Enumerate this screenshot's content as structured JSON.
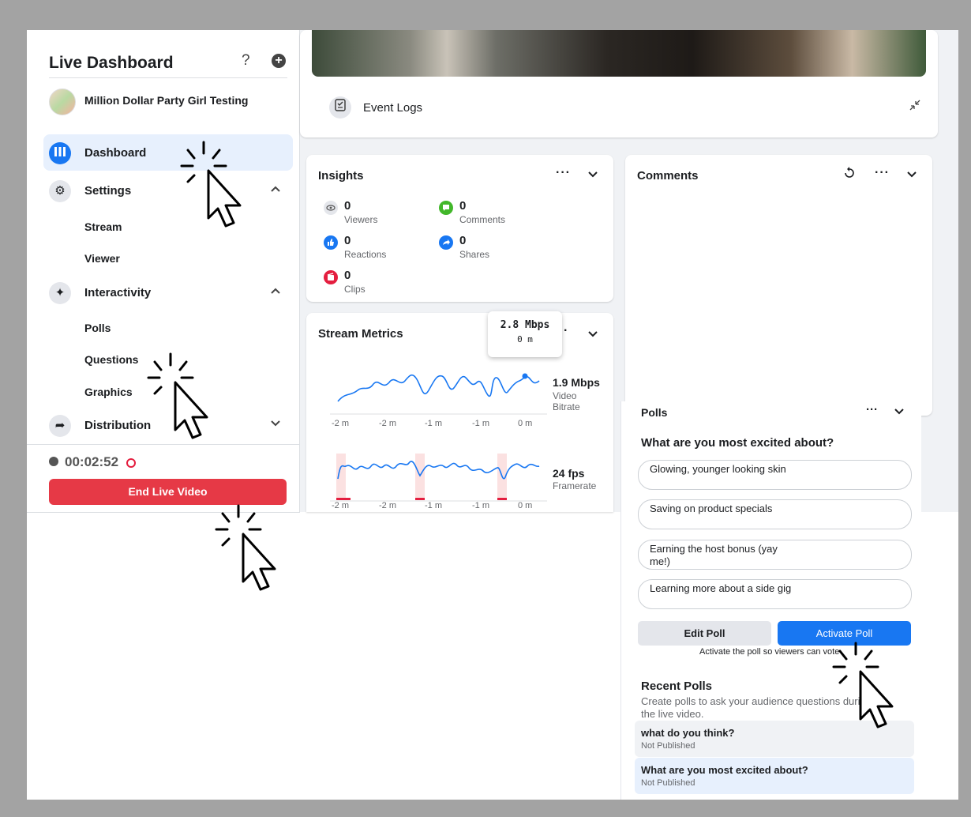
{
  "sidebar": {
    "title": "Live Dashboard",
    "help_glyph": "?",
    "add_glyph": "+",
    "page_name": "Million Dollar Party Girl Testing",
    "nav": [
      {
        "label": "Dashboard",
        "icon": "dashboard-icon"
      },
      {
        "label": "Settings",
        "icon": "gear-icon"
      },
      {
        "label": "Interactivity",
        "icon": "sparkle-icon"
      },
      {
        "label": "Distribution",
        "icon": "share-arrow-icon"
      }
    ],
    "settings_sub": [
      "Stream",
      "Viewer"
    ],
    "interactivity_sub": [
      "Polls",
      "Questions",
      "Graphics"
    ],
    "timer": "00:02:52",
    "end_label": "End Live Video"
  },
  "main": {
    "event_logs_label": "Event Logs"
  },
  "insights": {
    "title": "Insights",
    "metrics": [
      {
        "value": "0",
        "label": "Viewers",
        "color": "#e4e6eb"
      },
      {
        "value": "0",
        "label": "Comments",
        "color": "#42b72a"
      },
      {
        "value": "0",
        "label": "Reactions",
        "color": "#1877f2"
      },
      {
        "value": "0",
        "label": "Shares",
        "color": "#1877f2"
      },
      {
        "value": "0",
        "label": "Clips",
        "color": "#e41e3f"
      }
    ]
  },
  "comments": {
    "title": "Comments"
  },
  "stream_metrics": {
    "title": "Stream Metrics",
    "tooltip_value": "2.8 Mbps",
    "tooltip_time": "0 m",
    "bitrate_value": "1.9 Mbps",
    "bitrate_label_1": "Video",
    "bitrate_label_2": "Bitrate",
    "framerate_value": "24 fps",
    "framerate_label": "Framerate",
    "ticks": [
      "-2 m",
      "-2 m",
      "-1 m",
      "-1 m",
      "0 m"
    ],
    "line_color": "#1877f2"
  },
  "polls": {
    "title": "Polls",
    "question": "What are you most excited about?",
    "options": [
      "Glowing, younger looking skin",
      "Saving on product specials",
      "Earning the host bonus (yay me!)",
      "Learning more about a side gig"
    ],
    "edit_label": "Edit Poll",
    "activate_label": "Activate Poll",
    "activate_hint": "Activate the poll so viewers can vote",
    "recent_title": "Recent Polls",
    "recent_desc": "Create polls to ask your audience questions during the live video.",
    "recent": [
      {
        "question": "what do you think?",
        "status": "Not Published"
      },
      {
        "question": "What are you most excited about?",
        "status": "Not Published"
      }
    ]
  }
}
